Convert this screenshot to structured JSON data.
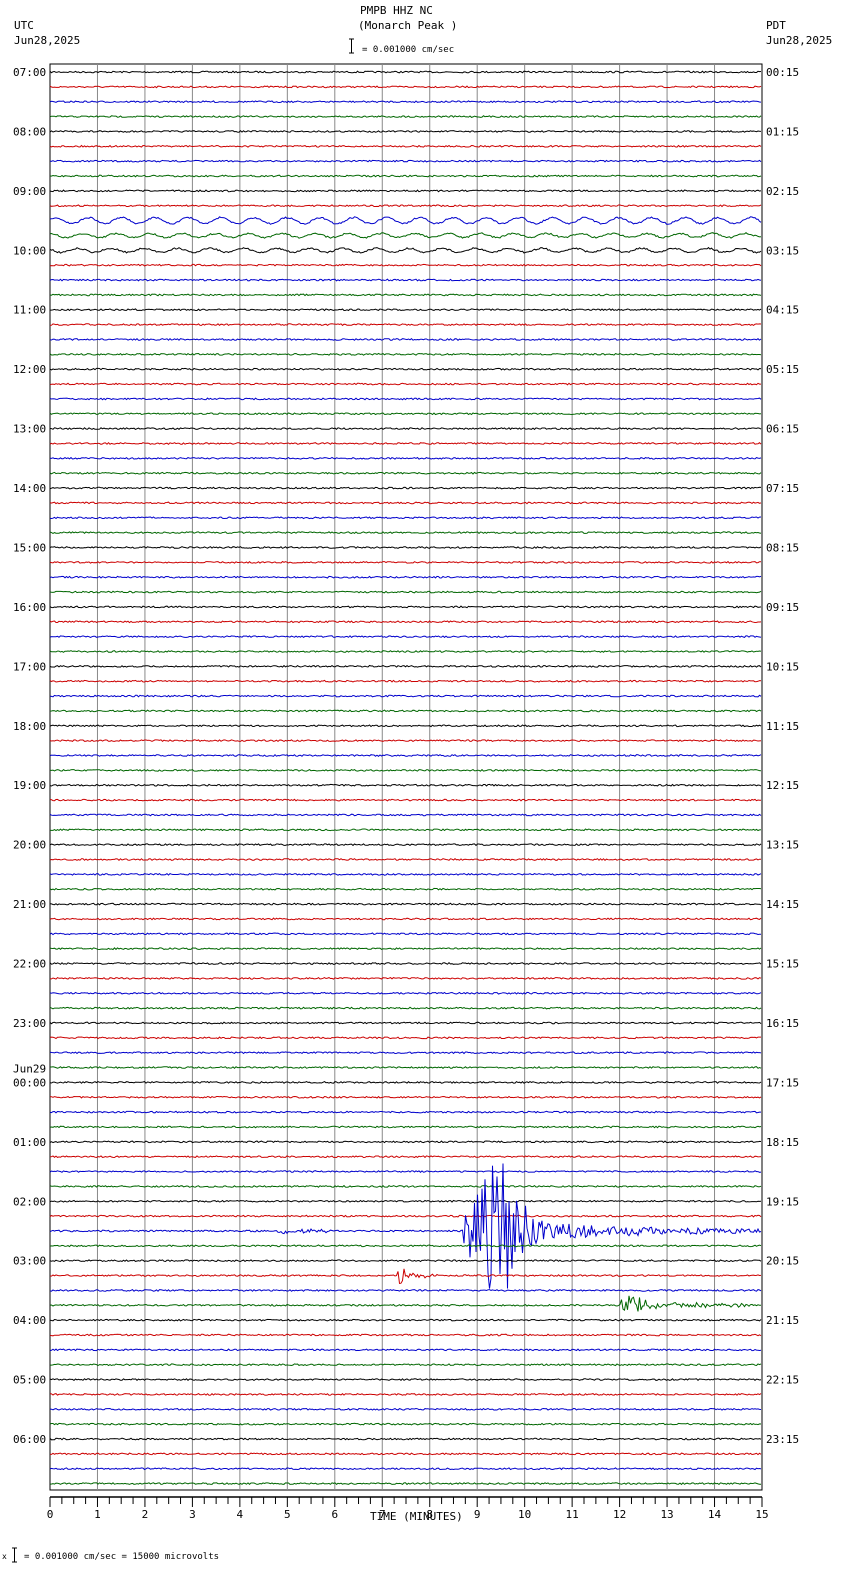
{
  "header": {
    "station": "PMPB HHZ NC",
    "location": "(Monarch Peak )",
    "left_tz": "UTC",
    "left_date": "Jun28,2025",
    "right_tz": "PDT",
    "right_date": "Jun28,2025",
    "scale": "= 0.001000 cm/sec"
  },
  "footer": {
    "scale": "= 0.001000 cm/sec =   15000 microvolts",
    "mark": "x"
  },
  "chart_data": {
    "type": "line",
    "title": "PMPB HHZ NC (Monarch Peak )",
    "xlabel": "TIME (MINUTES)",
    "xlim": [
      0,
      15
    ],
    "x_ticks": [
      "0",
      "1",
      "2",
      "3",
      "4",
      "5",
      "6",
      "7",
      "8",
      "9",
      "10",
      "11",
      "12",
      "13",
      "14",
      "15"
    ],
    "rows_per_hour": 4,
    "trace_colors": [
      "#000000",
      "#cc0000",
      "#0000cc",
      "#006600"
    ],
    "utc_labels": [
      "07:00",
      "08:00",
      "09:00",
      "10:00",
      "11:00",
      "12:00",
      "13:00",
      "14:00",
      "15:00",
      "16:00",
      "17:00",
      "18:00",
      "19:00",
      "20:00",
      "21:00",
      "22:00",
      "23:00",
      "00:00",
      "01:00",
      "02:00",
      "03:00",
      "04:00",
      "05:00",
      "06:00"
    ],
    "date_change_label": "Jun29",
    "pdt_labels": [
      "00:15",
      "01:15",
      "02:15",
      "03:15",
      "04:15",
      "05:15",
      "06:15",
      "07:15",
      "08:15",
      "09:15",
      "10:15",
      "11:15",
      "12:15",
      "13:15",
      "14:15",
      "15:15",
      "16:15",
      "17:15",
      "18:15",
      "19:15",
      "20:15",
      "21:15",
      "22:15",
      "23:15"
    ],
    "events": [
      {
        "row": 10,
        "start_min": 0,
        "end_min": 15,
        "amplitude": 3,
        "kind": "wavy"
      },
      {
        "row": 11,
        "start_min": 0,
        "end_min": 15,
        "amplitude": 2,
        "kind": "wavy"
      },
      {
        "row": 12,
        "start_min": 0,
        "end_min": 15,
        "amplitude": 2,
        "kind": "wavy"
      },
      {
        "row": 78,
        "start_min": 4.8,
        "end_min": 6.0,
        "amplitude": 2,
        "kind": "quake"
      },
      {
        "row": 78,
        "start_min": 8.7,
        "end_min": 15,
        "amplitude": 60,
        "kind": "quake"
      },
      {
        "row": 81,
        "start_min": 7.3,
        "end_min": 8.2,
        "amplitude": 8,
        "kind": "quake"
      },
      {
        "row": 83,
        "start_min": 12.0,
        "end_min": 14.8,
        "amplitude": 9,
        "kind": "quake"
      }
    ]
  }
}
